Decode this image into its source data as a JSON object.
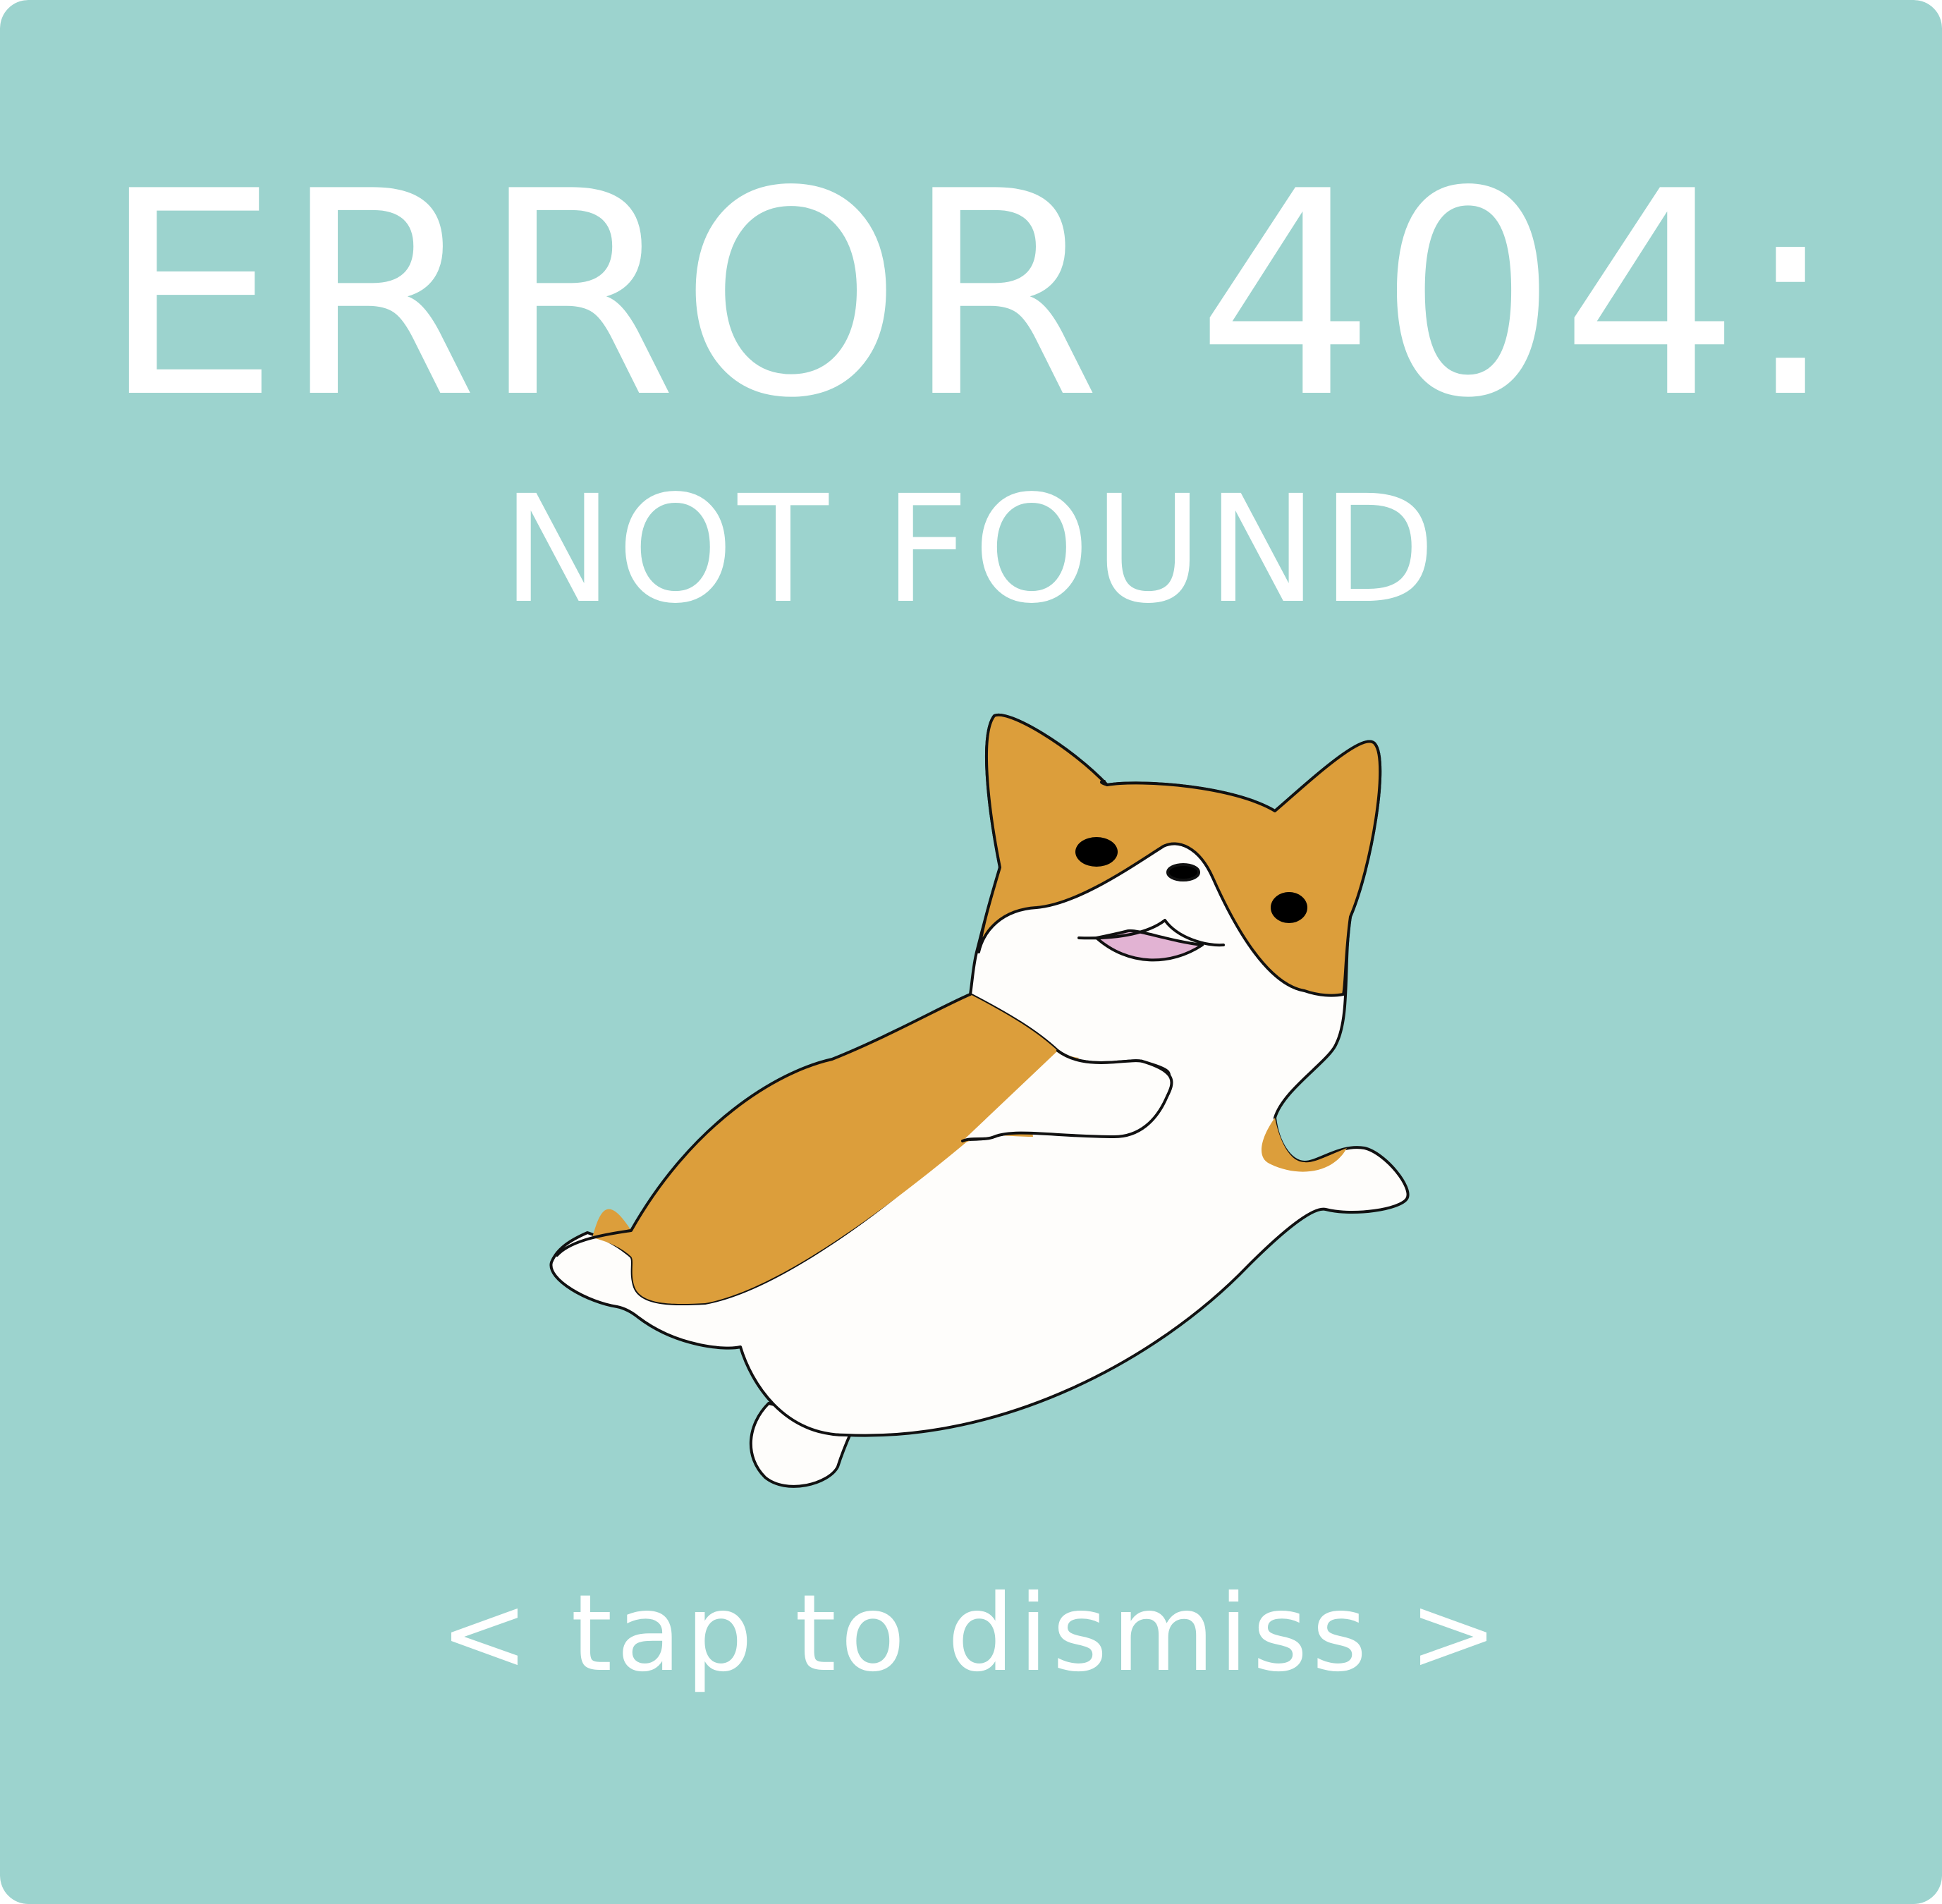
{
  "colors": {
    "background": "#9cd3ce",
    "text": "#ffffff",
    "fur_orange": "#dc9e3b",
    "fur_white": "#fefdfb",
    "outline": "#111111",
    "tongue": "#e2b3d3"
  },
  "error": {
    "title": "ERROR 404:",
    "subtitle": "NOT FOUND"
  },
  "illustration": {
    "icon": "corgi-illustration"
  },
  "dismiss": {
    "label": "< tap to dismiss >"
  }
}
